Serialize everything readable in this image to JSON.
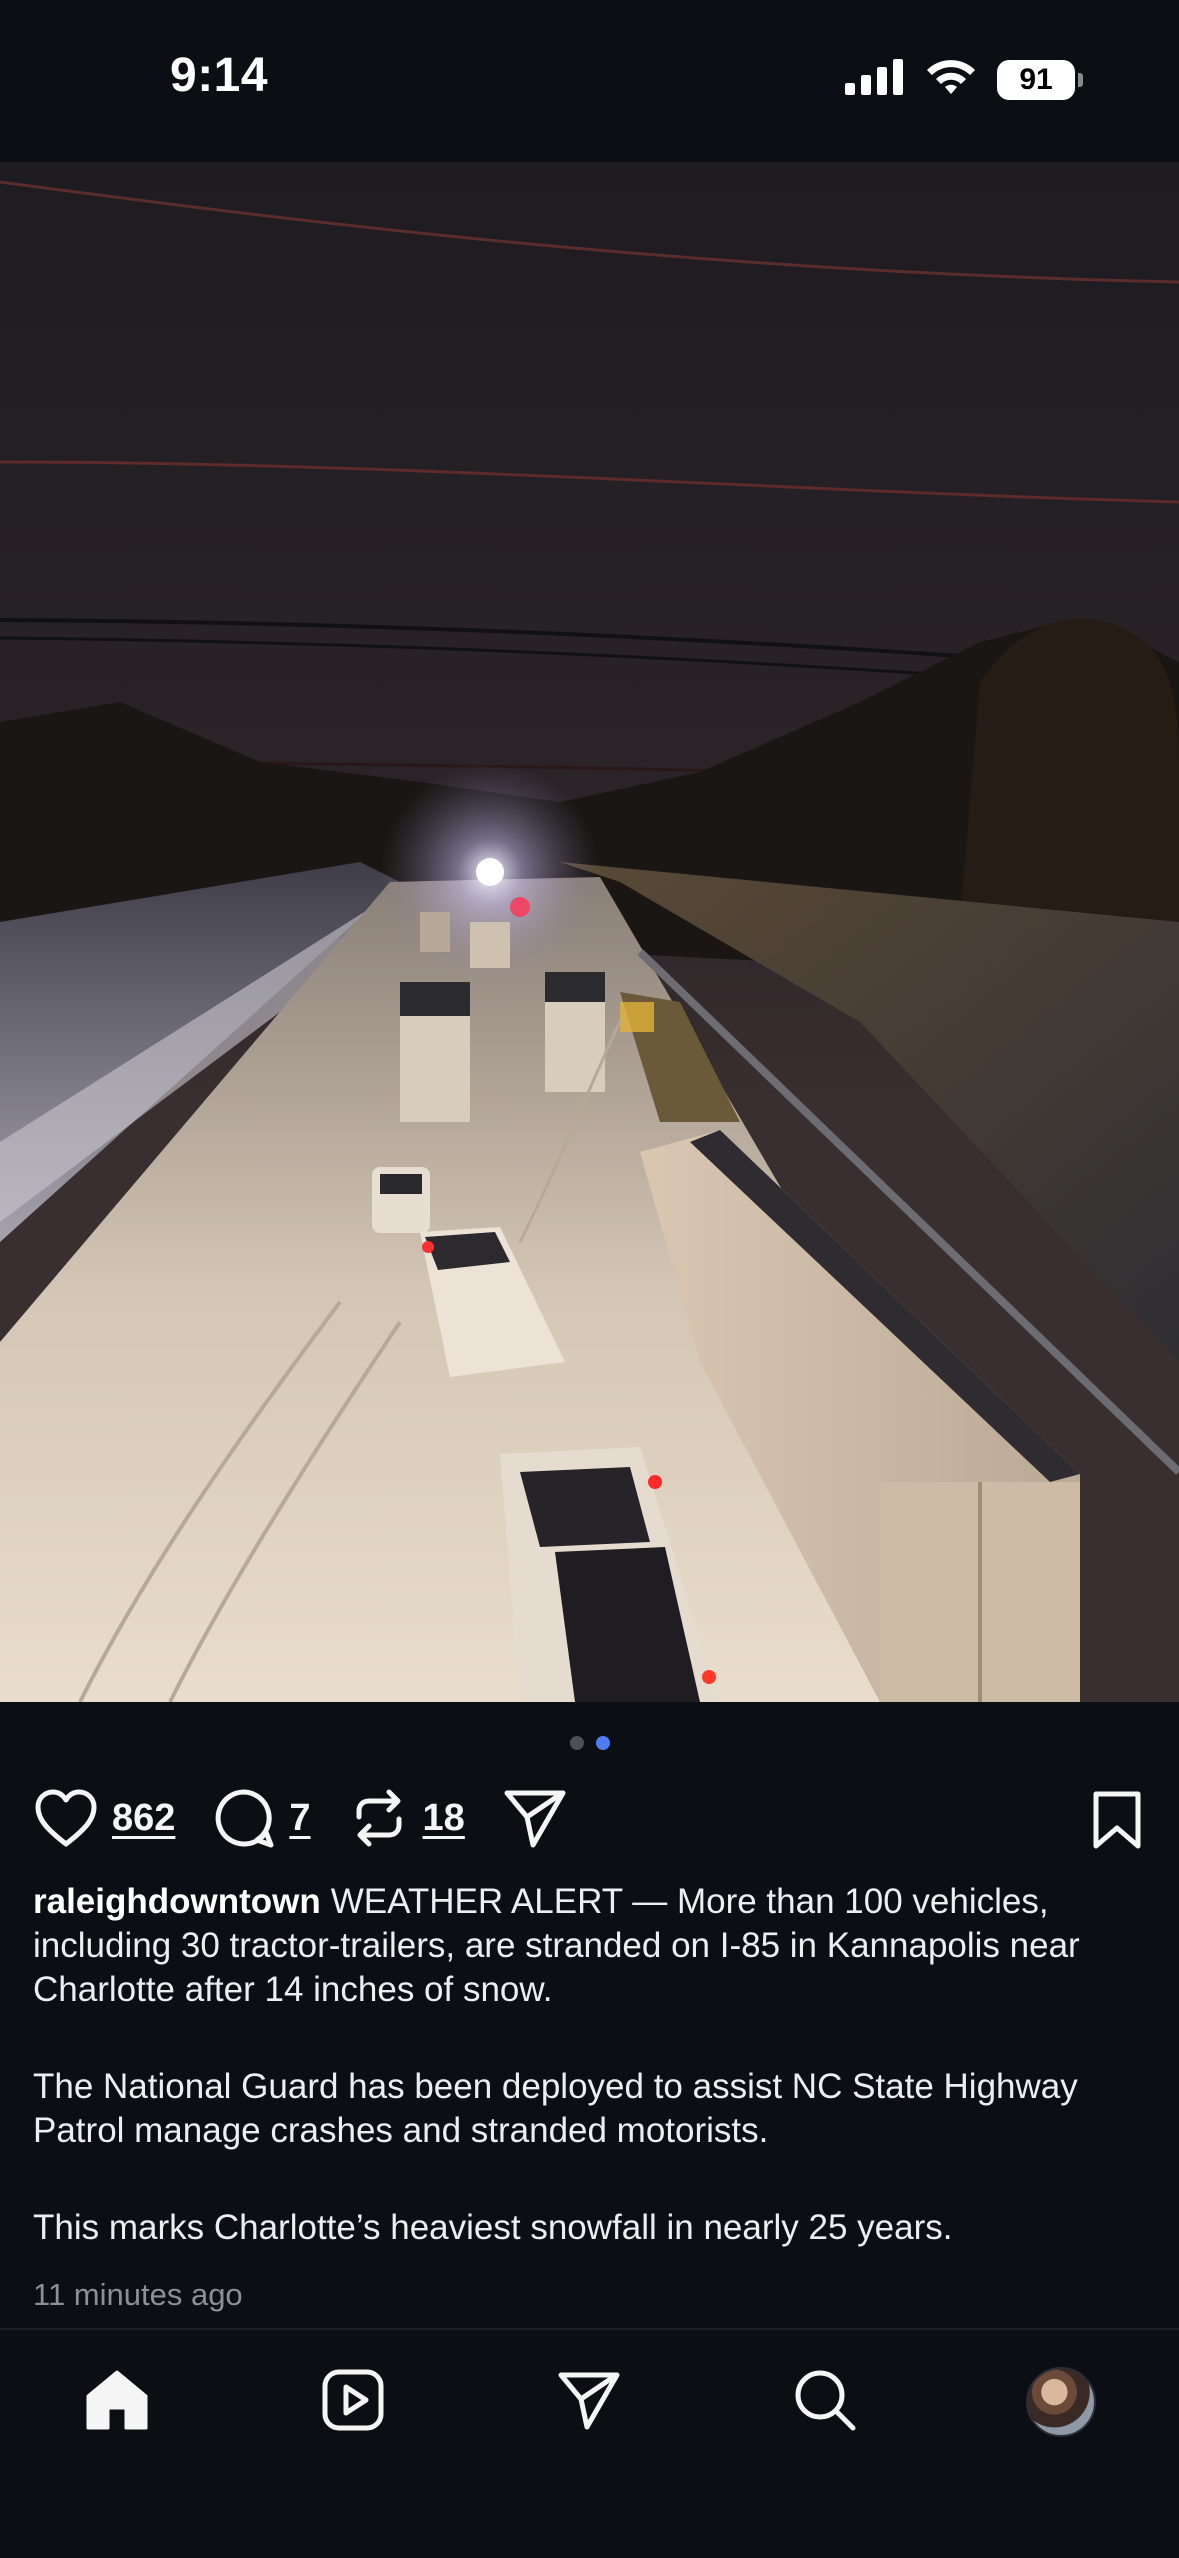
{
  "status_bar": {
    "time": "9:14",
    "battery": "91",
    "icons": [
      "signal-icon",
      "wifi-icon",
      "battery-icon"
    ]
  },
  "post": {
    "image_alt": "",
    "carousel": {
      "count": 2,
      "active_index": 1
    },
    "actions": {
      "likes": "862",
      "comments": "7",
      "reposts": "18"
    },
    "username": "raleighdowntown",
    "caption_first": "WEATHER ALERT — More than 100 vehicles, including 30 tractor-trailers, are stranded on I-85 in Kannapolis near Charlotte after 14 inches of snow.",
    "caption_second": "The National Guard has been deployed to assist NC State Highway Patrol manage crashes and stranded motorists.",
    "caption_third": "This marks Charlotte’s heaviest snowfall in nearly 25 years.",
    "timestamp": "11 minutes ago"
  },
  "nav": {
    "items": [
      "home-icon",
      "reels-icon",
      "send-icon",
      "search-icon",
      "profile-avatar"
    ],
    "active": "home-icon"
  },
  "colors": {
    "background": "#0b0f14",
    "accent": "#4f7cf2",
    "muted": "#8b9098"
  }
}
